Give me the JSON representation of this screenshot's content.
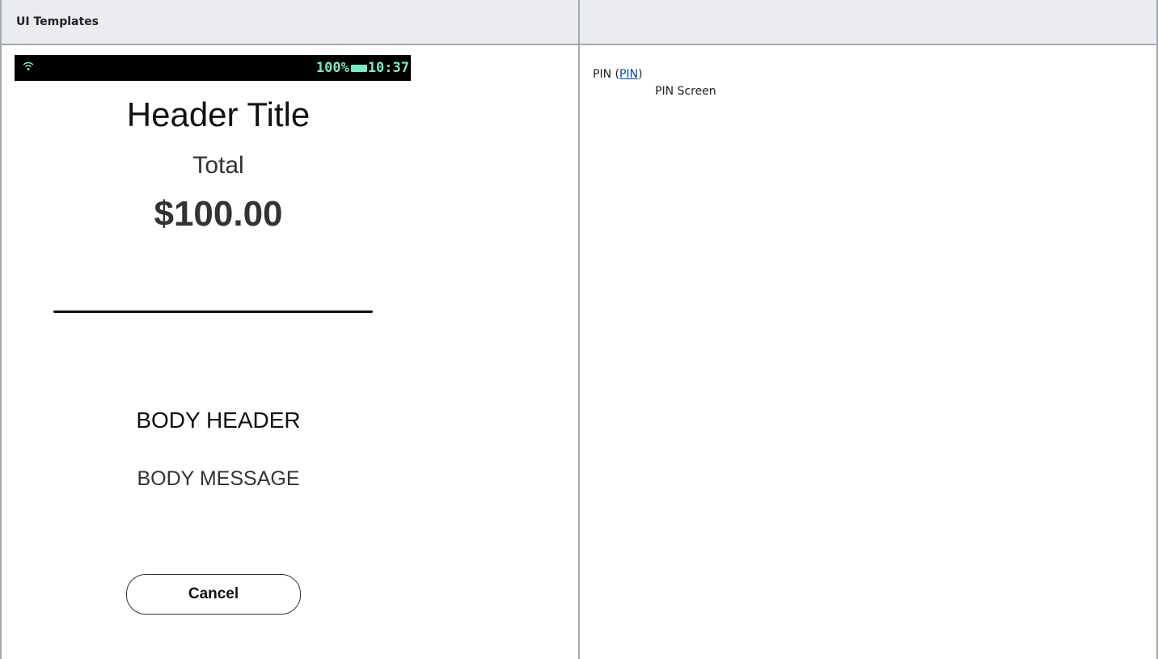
{
  "table": {
    "header_left": "UI Templates",
    "header_right": ""
  },
  "device": {
    "statusbar": {
      "battery_text": "100%",
      "time": "10:37",
      "accent_color": "#7ee8c4"
    },
    "header_title": "Header Title",
    "total_label": "Total",
    "total_amount": "$100.00",
    "body_header": "BODY HEADER",
    "body_message": "BODY MESSAGE",
    "cancel_label": "Cancel"
  },
  "definition": {
    "term_prefix": "PIN (",
    "term_link": "PIN",
    "term_suffix": ")",
    "description": "PIN Screen"
  },
  "colors": {
    "header_bg": "#eaecf0",
    "border": "#a2a9b1",
    "link": "#0645ad"
  }
}
